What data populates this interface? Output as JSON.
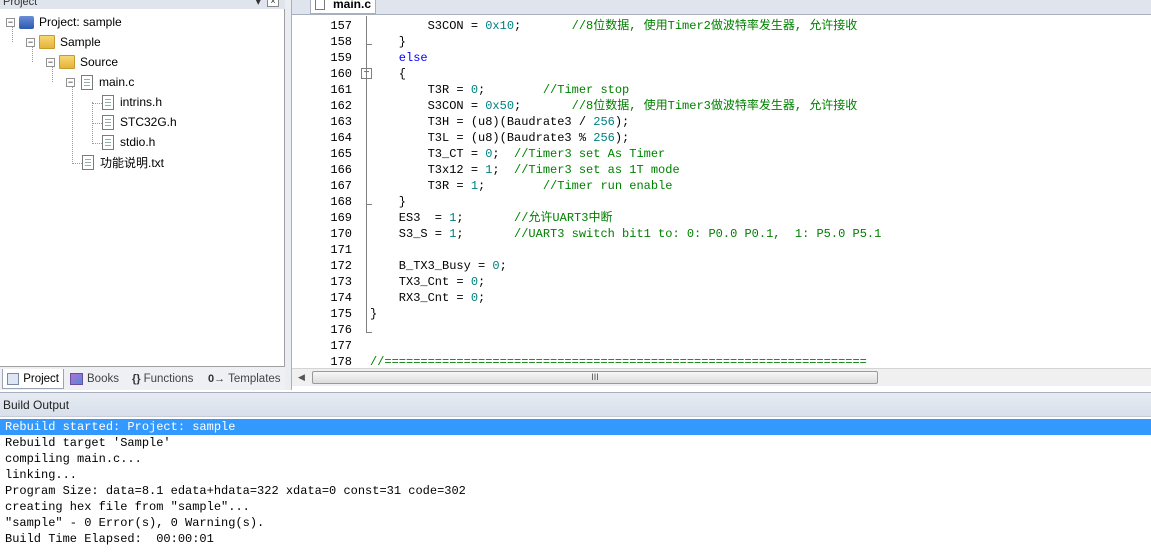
{
  "project_panel": {
    "header": "Project",
    "tree": {
      "project": "Project: sample",
      "target": "Sample",
      "group": "Source",
      "file": "main.c",
      "includes": [
        "intrins.h",
        "STC32G.h",
        "stdio.h"
      ],
      "doc": "功能说明.txt"
    },
    "tabs": [
      {
        "label": "Project",
        "icon": "project-icon"
      },
      {
        "label": "Books",
        "icon": "books-icon"
      },
      {
        "label": "Functions",
        "icon": "functions-icon",
        "glyph": "{}"
      },
      {
        "label": "Templates",
        "icon": "templates-icon",
        "glyph": "0→"
      }
    ]
  },
  "editor": {
    "tab_label": "main.c",
    "lines": [
      {
        "n": "157",
        "html": "        <span class=\"s\">S3CON = <span class=\"num\">0x10</span>;       <span class=\"cm\">//8位数据, 使用Timer2做波特率发生器, 允许接收</span></span>"
      },
      {
        "n": "158",
        "text": "    }"
      },
      {
        "n": "159",
        "text": "    else",
        "kw": true
      },
      {
        "n": "160",
        "text": "    {"
      },
      {
        "n": "161",
        "code": "        T3R = ",
        "num": "0",
        "rest": ";        ",
        "comment": "//Timer stop"
      },
      {
        "n": "162",
        "code": "        S3CON = ",
        "num": "0x50",
        "rest": ";       ",
        "comment": "//8位数据, 使用Timer3做波特率发生器, 允许接收"
      },
      {
        "n": "163",
        "code": "        T3H = (u8)(Baudrate3 / ",
        "num": "256",
        "rest": ");",
        "comment": ""
      },
      {
        "n": "164",
        "code": "        T3L = (u8)(Baudrate3 % ",
        "num": "256",
        "rest": ");",
        "comment": ""
      },
      {
        "n": "165",
        "code": "        T3_CT = ",
        "num": "0",
        "rest": ";  ",
        "comment": "//Timer3 set As Timer"
      },
      {
        "n": "166",
        "code": "        T3x12 = ",
        "num": "1",
        "rest": ";  ",
        "comment": "//Timer3 set as 1T mode"
      },
      {
        "n": "167",
        "code": "        T3R = ",
        "num": "1",
        "rest": ";        ",
        "comment": "//Timer run enable"
      },
      {
        "n": "168",
        "text": "    }"
      },
      {
        "n": "169",
        "code": "    ES3  = ",
        "num": "1",
        "rest": ";       ",
        "comment": "//允许UART3中断"
      },
      {
        "n": "170",
        "code": "    S3_S = ",
        "num": "1",
        "rest": ";       ",
        "comment": "//UART3 switch bit1 to: 0: P0.0 P0.1,  1: P5.0 P5.1"
      },
      {
        "n": "171",
        "text": ""
      },
      {
        "n": "172",
        "code": "    B_TX3_Busy = ",
        "num": "0",
        "rest": ";",
        "comment": ""
      },
      {
        "n": "173",
        "code": "    TX3_Cnt = ",
        "num": "0",
        "rest": ";",
        "comment": ""
      },
      {
        "n": "174",
        "code": "    RX3_Cnt = ",
        "num": "0",
        "rest": ";",
        "comment": ""
      },
      {
        "n": "175",
        "text": "}"
      },
      {
        "n": "176",
        "text": ""
      },
      {
        "n": "177",
        "text": ""
      },
      {
        "n": "178",
        "comment_only": "//==================================================================="
      }
    ],
    "scroll_thumb": "III"
  },
  "build_output": {
    "header": "Build Output",
    "lines": [
      "Rebuild started: Project: sample",
      "Rebuild target 'Sample'",
      "compiling main.c...",
      "linking...",
      "Program Size: data=8.1 edata+hdata=322 xdata=0 const=31 code=302",
      "creating hex file from \"sample\"...",
      "\"sample\" - 0 Error(s), 0 Warning(s).",
      "Build Time Elapsed:  00:00:01"
    ],
    "selected_index": 0
  },
  "colors": {
    "keyword": "#0000ff",
    "number": "#008080",
    "comment": "#008000",
    "selection": "#3399ff"
  }
}
